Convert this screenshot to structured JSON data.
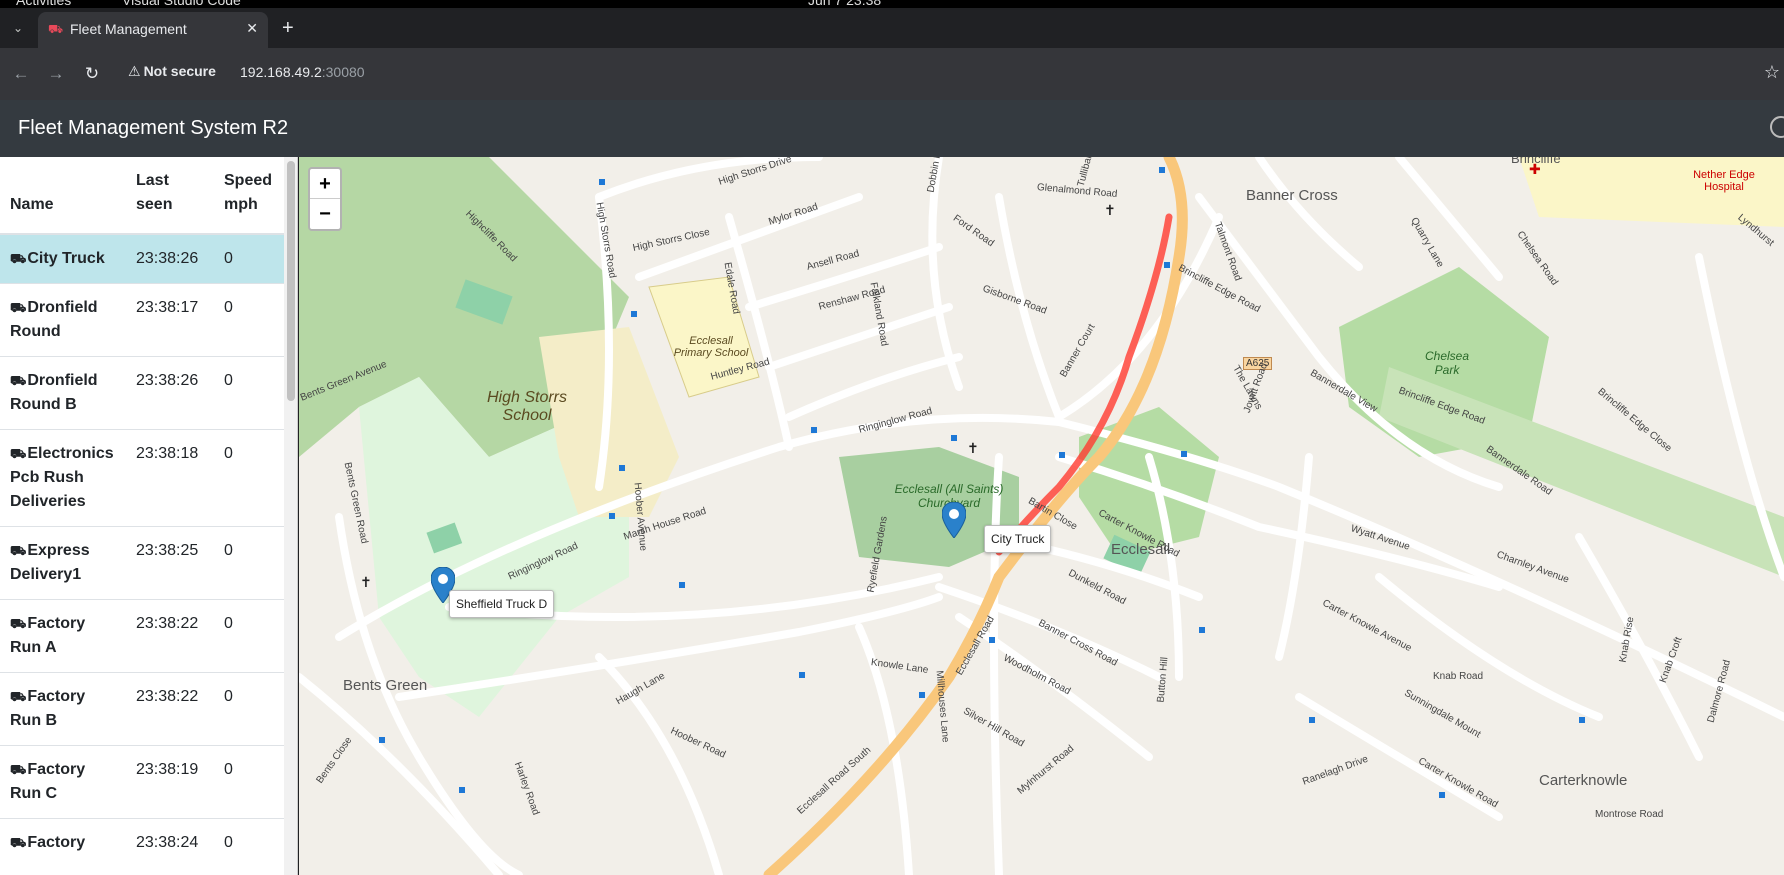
{
  "os": {
    "left": "Activities",
    "app": "Visual Studio Code",
    "clock": "Jun 7  23:38"
  },
  "browser": {
    "tab_title": "Fleet Management",
    "security_label": "Not secure",
    "url_host": "192.168.49.2",
    "url_port": ":30080"
  },
  "app": {
    "title": "Fleet Management System R2"
  },
  "table": {
    "headers": {
      "name": "Name",
      "last_seen": "Last seen",
      "speed": "Speed mph"
    },
    "rows": [
      {
        "name": "City Truck",
        "last_seen": "23:38:26",
        "speed": "0",
        "selected": true
      },
      {
        "name": "Dronfield Round",
        "last_seen": "23:38:17",
        "speed": "0"
      },
      {
        "name": "Dronfield Round B",
        "last_seen": "23:38:26",
        "speed": "0"
      },
      {
        "name": "Electronics Pcb Rush Deliveries",
        "last_seen": "23:38:18",
        "speed": "0"
      },
      {
        "name": "Express Delivery1",
        "last_seen": "23:38:25",
        "speed": "0"
      },
      {
        "name": "Factory Run A",
        "last_seen": "23:38:22",
        "speed": "0"
      },
      {
        "name": "Factory Run B",
        "last_seen": "23:38:22",
        "speed": "0"
      },
      {
        "name": "Factory Run C",
        "last_seen": "23:38:19",
        "speed": "0"
      },
      {
        "name": "Factory",
        "last_seen": "23:38:24",
        "speed": "0"
      }
    ]
  },
  "map": {
    "zoom_in": "+",
    "zoom_out": "−",
    "vehicles": {
      "city_truck": "City Truck",
      "sheffield_truck_d": "Sheffield Truck D"
    },
    "places": {
      "banner_cross": "Banner Cross",
      "ecclesall": "Ecclesall",
      "bents_green": "Bents Green",
      "carterknowle": "Carterknowle",
      "high_storrs_school": "High Storrs School",
      "ecclesall_primary": "Ecclesall Primary School",
      "churchyard": "Ecclesall (All Saints) Churchyard",
      "chelsea_park": "Chelsea Park",
      "hospital": "Nether Edge Hospital",
      "brincliffe": "Brincliffe"
    },
    "roads": {
      "a625": "A625",
      "ringinglow_road": "Ringinglow Road",
      "knowle_lane": "Knowle Lane",
      "ecclesall_road_south": "Ecclesall Road South",
      "ecclesall_road": "Ecclesall Road",
      "high_storrs_road": "High Storrs Road",
      "high_storrs_drive": "High Storrs Drive",
      "high_storrs_close": "High Storrs Close",
      "mylor_road": "Mylor Road",
      "ansell_road": "Ansell Road",
      "renshaw_road": "Renshaw Road",
      "huntley_road": "Huntley Road",
      "edale_road": "Edale Road",
      "falkland_road": "Falkland Road",
      "gisborne_road": "Gisborne Road",
      "ford_road": "Ford Road",
      "glenalmond_road": "Glenalmond Road",
      "brincliffe_edge_road": "Brincliffe Edge Road",
      "carter_knowle_road": "Carter Knowle Road",
      "carter_knowle_avenue": "Carter Knowle Avenue",
      "marsh_house_road": "Marsh House Road",
      "hoober_avenue": "Hoober Avenue",
      "hoober_road": "Hoober Road",
      "haugh_lane": "Haugh Lane",
      "dunkeld_road": "Dunkeld Road",
      "banner_cross_road": "Banner Cross Road",
      "woodholm_road": "Woodholm Road",
      "silver_hill_road": "Silver Hill Road",
      "millhouses_lane": "Millhouses Lane",
      "bents_green_road": "Bents Green Road",
      "bents_green_avenue": "Bents Green Avenue",
      "highcliffe_road": "Highcliffe Road",
      "knab_road": "Knab Road",
      "wyatt_avenue": "Wyatt Avenue",
      "charnley_avenue": "Charnley Avenue",
      "bannerdale_road": "Bannerdale Road",
      "bannerdale_view": "Bannerdale View",
      "sunningdale_mount": "Sunningdale Mount",
      "ranelagh_drive": "Ranelagh Drive",
      "montrose_road": "Montrose Road",
      "chelsea_road": "Chelsea Road",
      "quarry_lane": "Quarry Lane",
      "tullibardine_road": "Tullibardine Road",
      "dobbin_hill": "Dobbin Hill",
      "banner_court": "Banner Court",
      "the_lawns": "The Lawns",
      "jowitt_road": "Jowitt Road",
      "ryefield_gardens": "Ryefield Gardens",
      "bartin_close": "Bartin Close",
      "brincliffe_edge_close": "Brincliffe Edge Close",
      "lyndhurst": "Lyndhurst",
      "dalmore_road": "Dalmore Road",
      "knab_croft": "Knab Croft",
      "knab_rise": "Knab Rise",
      "button_hill": "Button Hill",
      "talmont_road": "Talmont Road",
      "harley_road": "Harley Road",
      "bents_close": "Bents Close",
      "mylnhurst_road": "Mylnhurst Road"
    }
  }
}
